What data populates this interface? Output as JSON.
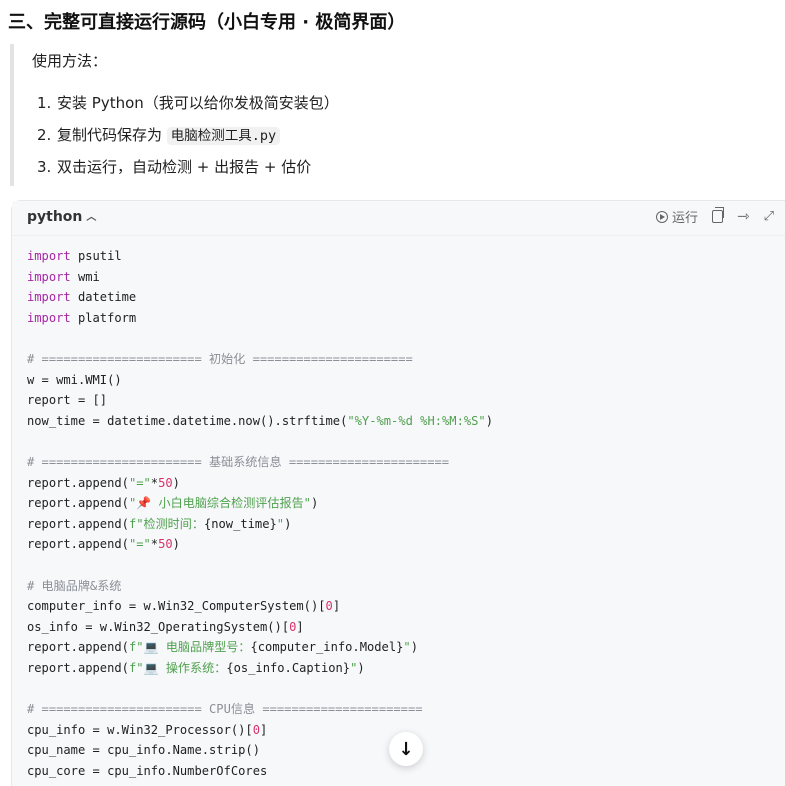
{
  "heading": "三、完整可直接运行源码（小白专用 · 极简界面）",
  "usage": {
    "title": "使用方法：",
    "steps": [
      {
        "num": "1.",
        "text": "安装 Python（我可以给你发极简安装包）"
      },
      {
        "num": "2.",
        "text": "复制代码保存为 ",
        "code": "电脑检测工具.py"
      },
      {
        "num": "3.",
        "text": "双击运行，自动检测 + 出报告 + 估价"
      }
    ]
  },
  "codeblock": {
    "language": "python",
    "run_label": "运行",
    "icons": {
      "language_toggle": "chevron-up-icon",
      "run": "play-circle-icon",
      "copy": "copy-icon",
      "share": "share-arrow-icon",
      "expand": "expand-icon"
    },
    "lines": [
      [
        {
          "t": "import",
          "c": "kw"
        },
        {
          "t": " psutil"
        }
      ],
      [
        {
          "t": "import",
          "c": "kw"
        },
        {
          "t": " wmi"
        }
      ],
      [
        {
          "t": "import",
          "c": "kw"
        },
        {
          "t": " datetime"
        }
      ],
      [
        {
          "t": "import",
          "c": "kw"
        },
        {
          "t": " platform"
        }
      ],
      [],
      [
        {
          "t": "# ====================== 初始化 ======================",
          "c": "com"
        }
      ],
      [
        {
          "t": "w = wmi.WMI()"
        }
      ],
      [
        {
          "t": "report = []"
        }
      ],
      [
        {
          "t": "now_time = datetime.datetime.now().strftime("
        },
        {
          "t": "\"%Y-%m-%d %H:%M:%S\"",
          "c": "str"
        },
        {
          "t": ")"
        }
      ],
      [],
      [
        {
          "t": "# ====================== 基础系统信息 ======================",
          "c": "com"
        }
      ],
      [
        {
          "t": "report.append("
        },
        {
          "t": "\"=\"",
          "c": "str"
        },
        {
          "t": "*"
        },
        {
          "t": "50",
          "c": "num-lit"
        },
        {
          "t": ")"
        }
      ],
      [
        {
          "t": "report.append("
        },
        {
          "t": "\"📌 小白电脑综合检测评估报告\"",
          "c": "str"
        },
        {
          "t": ")"
        }
      ],
      [
        {
          "t": "report.append("
        },
        {
          "t": "f\"检测时间：",
          "c": "str"
        },
        {
          "t": "{now_time}"
        },
        {
          "t": "\"",
          "c": "str"
        },
        {
          "t": ")"
        }
      ],
      [
        {
          "t": "report.append("
        },
        {
          "t": "\"=\"",
          "c": "str"
        },
        {
          "t": "*"
        },
        {
          "t": "50",
          "c": "num-lit"
        },
        {
          "t": ")"
        }
      ],
      [],
      [
        {
          "t": "# 电脑品牌&系统",
          "c": "com"
        }
      ],
      [
        {
          "t": "computer_info = w.Win32_ComputerSystem()["
        },
        {
          "t": "0",
          "c": "num-lit"
        },
        {
          "t": "]"
        }
      ],
      [
        {
          "t": "os_info = w.Win32_OperatingSystem()["
        },
        {
          "t": "0",
          "c": "num-lit"
        },
        {
          "t": "]"
        }
      ],
      [
        {
          "t": "report.append("
        },
        {
          "t": "f\"💻 电脑品牌型号：",
          "c": "str"
        },
        {
          "t": "{computer_info.Model}"
        },
        {
          "t": "\"",
          "c": "str"
        },
        {
          "t": ")"
        }
      ],
      [
        {
          "t": "report.append("
        },
        {
          "t": "f\"💻 操作系统：",
          "c": "str"
        },
        {
          "t": "{os_info.Caption}"
        },
        {
          "t": "\"",
          "c": "str"
        },
        {
          "t": ")"
        }
      ],
      [],
      [
        {
          "t": "# ====================== CPU信息 ======================",
          "c": "com"
        }
      ],
      [
        {
          "t": "cpu_info = w.Win32_Processor()["
        },
        {
          "t": "0",
          "c": "num-lit"
        },
        {
          "t": "]"
        }
      ],
      [
        {
          "t": "cpu_name = cpu_info.Name.strip()"
        }
      ],
      [
        {
          "t": "cpu_core = cpu_info.NumberOfCores"
        }
      ]
    ]
  },
  "scroll_button": {
    "icon": "arrow-down-icon",
    "glyph": "↓"
  }
}
